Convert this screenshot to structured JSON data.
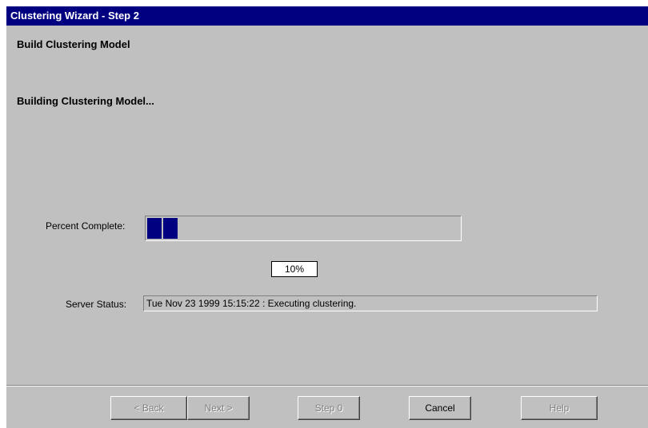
{
  "window": {
    "title": "Clustering Wizard - Step 2"
  },
  "page": {
    "step_heading": "Build Clustering Model",
    "status_heading": "Building Clustering Model..."
  },
  "progress": {
    "label": "Percent Complete:",
    "value": 0.1,
    "percent_text": "10%",
    "fill_color": "#000080"
  },
  "server": {
    "label": "Server Status:",
    "status_text": "Tue Nov 23 1999 15:15:22 : Executing clustering."
  },
  "buttons": {
    "back": "< Back",
    "next": "Next >",
    "step0": "Step 0",
    "cancel": "Cancel",
    "help": "Help"
  }
}
